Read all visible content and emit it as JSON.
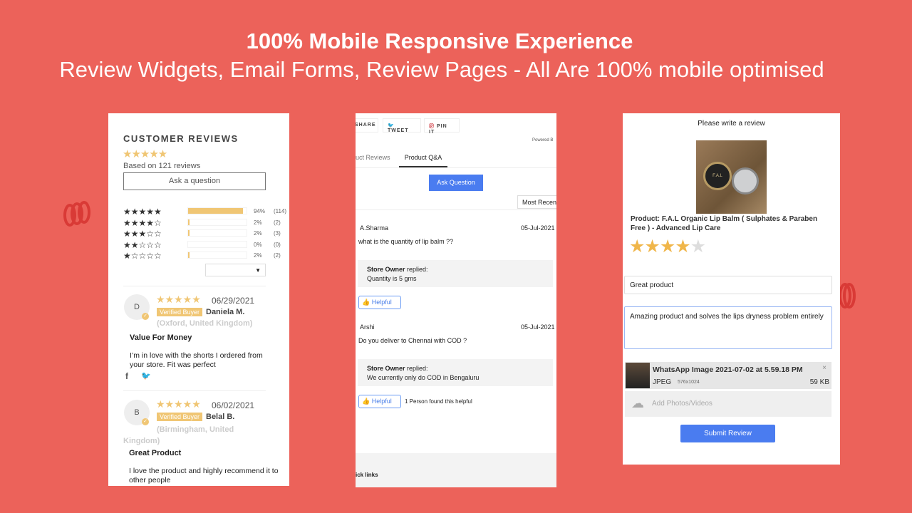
{
  "header": {
    "title": "100% Mobile Responsive Experience",
    "subtitle": "Review Widgets, Email Forms, Review Pages - All Are 100% mobile optimised"
  },
  "colors": {
    "background": "#ec625a",
    "star": "#f0c674",
    "primary_button": "#4a7cf0"
  },
  "widget": {
    "title": "CUSTOMER REVIEWS",
    "average_stars": 5,
    "based_on": "Based on 121 reviews",
    "ask_button": "Ask a question",
    "histogram": [
      {
        "stars": 5,
        "percent": "94%",
        "count": "(114)",
        "fill": 94
      },
      {
        "stars": 4,
        "percent": "2%",
        "count": "(2)",
        "fill": 2
      },
      {
        "stars": 3,
        "percent": "2%",
        "count": "(3)",
        "fill": 2
      },
      {
        "stars": 2,
        "percent": "0%",
        "count": "(0)",
        "fill": 0
      },
      {
        "stars": 1,
        "percent": "2%",
        "count": "(2)",
        "fill": 2
      }
    ],
    "reviews": [
      {
        "initial": "D",
        "date": "06/29/2021",
        "badge": "Verified Buyer",
        "name": "Daniela M.",
        "location": "(Oxford, United Kingdom)",
        "title": "Value For Money",
        "body": "I’m in love with the shorts I ordered from your store. Fit was perfect"
      },
      {
        "initial": "B",
        "date": "06/02/2021",
        "badge": "Verified Buyer",
        "name": "Belal B.",
        "location": "(Birmingham, United Kingdom)",
        "title": "Great Product",
        "body": "I love the product and highly recommend it to other people"
      }
    ]
  },
  "qa": {
    "share": "SHARE",
    "tweet": "TWEET",
    "pin": "PIN IT",
    "powered": "Powered B",
    "tabs": [
      "uct Reviews",
      "Product Q&A"
    ],
    "ask_button": "Ask Question",
    "sort": "Most Recen",
    "questions": [
      {
        "author": "A.Sharma",
        "date": "05-Jul-2021",
        "question": "what is the quantity of lip balm ??",
        "replier": "Store Owner",
        "replied": "replied:",
        "answer": "Quantity is 5 gms",
        "helpful": "Helpful",
        "helpful_note": ""
      },
      {
        "author": "Arshi",
        "date": "05-Jul-2021",
        "question": "Do you deliver to Chennai with COD ?",
        "replier": "Store Owner",
        "replied": "replied:",
        "answer": "We currently only do COD in Bengaluru",
        "helpful": "Helpful",
        "helpful_note": "1 Person found this helpful"
      }
    ],
    "footer": "ick links"
  },
  "form": {
    "title": "Please write a review",
    "product_image_label": "F.A.L",
    "product": "Product: F.A.L Organic Lip Balm ( Sulphates & Paraben Free ) - Advanced Lip Care",
    "rating": 4,
    "max_rating": 5,
    "review_title": "Great product",
    "review_body": "Amazing product and solves the lips dryness problem entirely",
    "attachment": {
      "name": "WhatsApp Image 2021-07-02 at 5.59.18 PM",
      "type": "JPEG",
      "dims": "576x1024",
      "size": "59 KB"
    },
    "add_media": "Add Photos/Videos",
    "submit": "Submit Review"
  }
}
